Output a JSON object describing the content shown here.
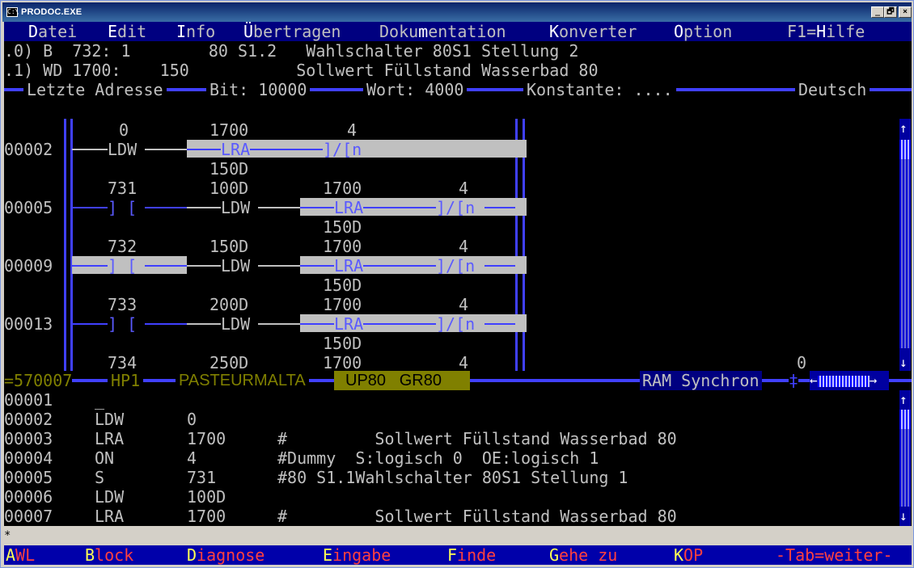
{
  "window": {
    "title": "PRODOC.EXE",
    "icon": "C:\\",
    "buttons": [
      "_",
      "🗗",
      "×"
    ]
  },
  "menu": [
    {
      "pre": "",
      "hk": "D",
      "post": "atei"
    },
    {
      "pre": "",
      "hk": "E",
      "post": "dit"
    },
    {
      "pre": "",
      "hk": "I",
      "post": "nfo"
    },
    {
      "pre": "",
      "hk": "Ü",
      "post": "bertragen"
    },
    {
      "pre": "Doku",
      "hk": "m",
      "post": "entation"
    },
    {
      "pre": "",
      "hk": "K",
      "post": "onverter"
    },
    {
      "pre": "",
      "hk": "O",
      "post": "ption"
    },
    {
      "pre": "F1=",
      "hk": "H",
      "post": "ilfe"
    }
  ],
  "info_lines": [
    ".0) B  732: 1        80 S1.2   Wahlschalter 80S1 Stellung 2",
    ".1) WD 1700:    150           Sollwert Füllstand Wasserbad 80"
  ],
  "address_bar": {
    "letzte": "Letzte Adresse",
    "bit": "Bit: 10000",
    "wort": "Wort: 4000",
    "konst": "Konstante: ....",
    "lang": "Deutsch"
  },
  "rungs": [
    {
      "num": "00002",
      "top": [
        "0",
        "1700",
        "4"
      ],
      "mid": [
        "LDW",
        "LRA",
        "]/[n"
      ],
      "bot": "150D"
    },
    {
      "num": "00005",
      "top": [
        "731",
        "100D",
        "1700",
        "4"
      ],
      "mid": [
        "] [",
        "LDW",
        "LRA",
        "]/[n"
      ],
      "bot": "150D"
    },
    {
      "num": "00009",
      "top": [
        "732",
        "150D",
        "1700",
        "4"
      ],
      "mid": [
        "] [",
        "LDW",
        "LRA",
        "]/[n"
      ],
      "bot": "150D"
    },
    {
      "num": "00013",
      "top": [
        "733",
        "200D",
        "1700",
        "4"
      ],
      "mid": [
        "] [",
        "LDW",
        "LRA",
        "]/[n"
      ],
      "bot": "150D"
    },
    {
      "num": "",
      "top": [
        "734",
        "250D",
        "1700",
        "4"
      ],
      "mid": [],
      "bot": ""
    }
  ],
  "side_value": "0",
  "status": {
    "prog": "570007",
    "hp": "HP1",
    "name": "PASTEURMALTA",
    "up": "UP80",
    "gr": "GR80",
    "ram": "RAM Synchron"
  },
  "awl": [
    {
      "n": "00001",
      "op": "_",
      "arg": "",
      "cmt": ""
    },
    {
      "n": "00002",
      "op": "LDW",
      "arg": "0",
      "cmt": ""
    },
    {
      "n": "00003",
      "op": "LRA",
      "arg": "1700",
      "cmt": "#         Sollwert Füllstand Wasserbad 80"
    },
    {
      "n": "00004",
      "op": "ON",
      "arg": "4",
      "cmt": "#Dummy  S:logisch 0  OE:logisch 1"
    },
    {
      "n": "00005",
      "op": "S",
      "arg": "731",
      "cmt": "#80 S1.1Wahlschalter 80S1 Stellung 1"
    },
    {
      "n": "00006",
      "op": "LDW",
      "arg": "100D",
      "cmt": ""
    },
    {
      "n": "00007",
      "op": "LRA",
      "arg": "1700",
      "cmt": "#         Sollwert Füllstand Wasserbad 80"
    }
  ],
  "prompt": "*",
  "fkeys": [
    {
      "hk": "A",
      "rest": "WL"
    },
    {
      "hk": "B",
      "rest": "lock"
    },
    {
      "hk": "D",
      "rest": "iagnose"
    },
    {
      "hk": "E",
      "rest": "ingabe"
    },
    {
      "hk": "F",
      "rest": "inde"
    },
    {
      "hk": "G",
      "rest": "ehe zu"
    },
    {
      "hk": "K",
      "rest": "OP"
    }
  ],
  "tab_hint": "-Tab=weiter-"
}
